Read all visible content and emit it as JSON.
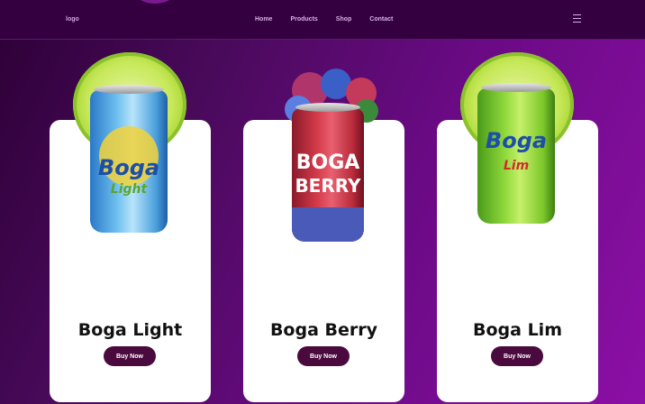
{
  "nav": {
    "logo": "logo",
    "links": [
      "Home",
      "Products",
      "Shop",
      "Contact"
    ],
    "menu_icon": "hamburger-menu-icon"
  },
  "products": [
    {
      "name": "Boga Light",
      "button": "Buy Now",
      "can_brand": "Boga",
      "can_flavor": "Light"
    },
    {
      "name": "Boga Berry",
      "button": "Buy Now",
      "can_brand": "BOGA",
      "can_flavor": "BERRY"
    },
    {
      "name": "Boga Lim",
      "button": "Buy Now",
      "can_brand": "Boga",
      "can_flavor": "Lim"
    }
  ],
  "colors": {
    "nav_bg": "#34003f",
    "button_bg": "#4a0a3e",
    "card_bg": "#ffffff"
  }
}
